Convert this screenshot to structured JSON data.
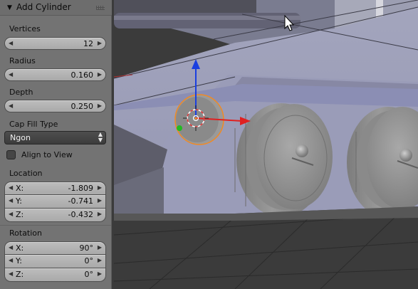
{
  "operator_panel": {
    "title": "Add Cylinder",
    "vertices": {
      "label": "Vertices",
      "value": "12"
    },
    "radius": {
      "label": "Radius",
      "value": "0.160"
    },
    "depth": {
      "label": "Depth",
      "value": "0.250"
    },
    "cap_fill_type": {
      "label": "Cap Fill Type",
      "value": "Ngon"
    },
    "align_to_view": {
      "label": "Align to View",
      "checked": false
    },
    "location": {
      "label": "Location",
      "x_label": "X:",
      "x": "-1.809",
      "y_label": "Y:",
      "y": "-0.741",
      "z_label": "Z:",
      "z": "-0.432"
    },
    "rotation": {
      "label": "Rotation",
      "x_label": "X:",
      "x": "90°",
      "y_label": "Y:",
      "y": "0°",
      "z_label": "Z:",
      "z": "0°"
    }
  },
  "colors": {
    "panel_bg": "#737373",
    "field_bg": "#b4b4b4",
    "select_bg": "#444444",
    "gizmo_x": "#e02020",
    "gizmo_z": "#1a3fe0",
    "selection_outline": "#f08a24"
  },
  "icons": {
    "collapse": "triangle-down-icon",
    "grip": "panel-grip-icon",
    "cursor": "mouse-pointer-icon",
    "manipulator": "transform-manipulator-icon"
  }
}
